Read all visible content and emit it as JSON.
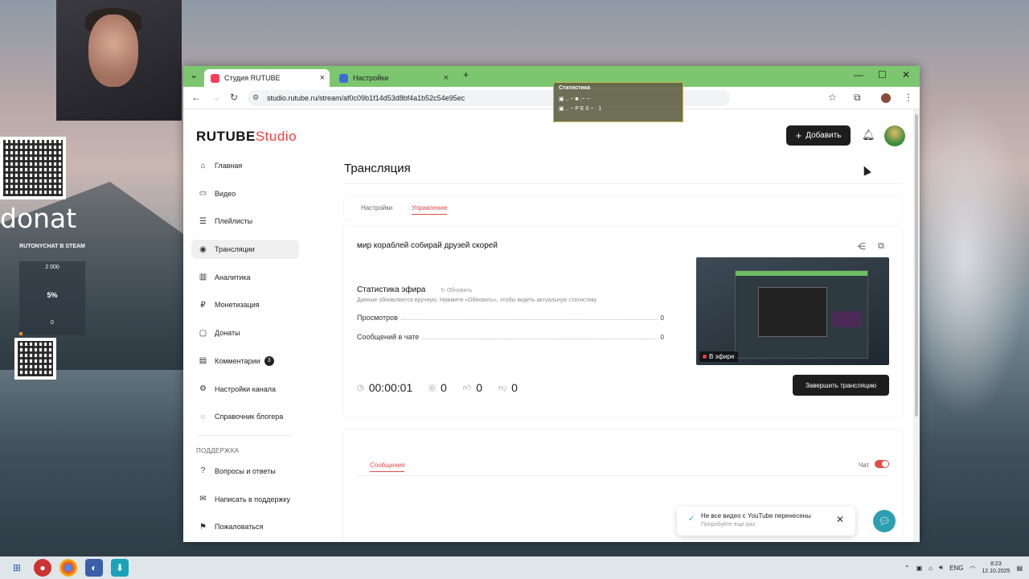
{
  "overlay": {
    "donat": "donat",
    "steam_label": "RUTONYCHAT В STEAM",
    "goal_top": "2 000",
    "goal_percent": "5%",
    "goal_bottom": "0",
    "goal_progress": 0.05,
    "stats_title": "Статистика",
    "stats_line1": "▣ .. ~ ■ .~ ~",
    "stats_line2": "▣ .. ~ P E 0 ~ . 1"
  },
  "browser": {
    "tabs": [
      {
        "label": "Студия RUTUBE",
        "close": "×"
      },
      {
        "label": "Настройки",
        "close": "×"
      }
    ],
    "new_tab": "+",
    "url": "studio.rutube.ru/stream/af0c09b1f14d53d8bf4a1b52c54e95ec",
    "window_controls": {
      "minimize": "—",
      "maximize": "☐",
      "close": "✕"
    }
  },
  "header": {
    "logo_main": "RUTUBE",
    "logo_studio": "Studio",
    "add_button": "Добавить",
    "add_icon": "+"
  },
  "sidebar": {
    "items": [
      {
        "label": "Главная",
        "icon": "⌂"
      },
      {
        "label": "Видео",
        "icon": "▭"
      },
      {
        "label": "Плейлисты",
        "icon": "☰"
      },
      {
        "label": "Трансляции",
        "icon": "◉"
      },
      {
        "label": "Аналитика",
        "icon": "▥"
      },
      {
        "label": "Монетизация",
        "icon": "₽"
      },
      {
        "label": "Донаты",
        "icon": "▢"
      },
      {
        "label": "Комментарии",
        "icon": "▤",
        "badge": "3"
      },
      {
        "label": "Настройки канала",
        "icon": "⚙"
      },
      {
        "label": "Справочник блогера",
        "icon": "◌"
      }
    ],
    "support_label": "ПОДДЕРЖКА",
    "support_items": [
      {
        "label": "Вопросы и ответы",
        "icon": "?"
      },
      {
        "label": "Написать в поддержку",
        "icon": "✉"
      },
      {
        "label": "Пожаловаться",
        "icon": "⚑"
      }
    ]
  },
  "main": {
    "title": "Трансляция",
    "tabs": [
      "Настройки",
      "Управление"
    ],
    "stream_name": "мир кораблей собирай друзей скорей",
    "stats_title": "Статистика эфира",
    "refresh_label": "Обновить",
    "stats_note": "Данные обновляются вручную. Нажмите «Обновить», чтобы видеть актуальную статистику",
    "stats": [
      {
        "label": "Просмотров",
        "value": "0"
      },
      {
        "label": "Сообщений в чате",
        "value": "0"
      }
    ],
    "duration": "00:00:01",
    "viewers": "0",
    "likes": "0",
    "dislikes": "0",
    "live_badge": "В эфире",
    "end_button": "Завершить трансляцию",
    "messages_tab": "Сообщения",
    "chat_label": "Чат",
    "chat_enabled": true
  },
  "toast": {
    "title": "Не все видео с YouTube перенесены",
    "subtitle": "Попробуйте еще раз"
  },
  "taskbar": {
    "lang": "ENG",
    "time": "8:23",
    "date": "12.10.2025"
  }
}
